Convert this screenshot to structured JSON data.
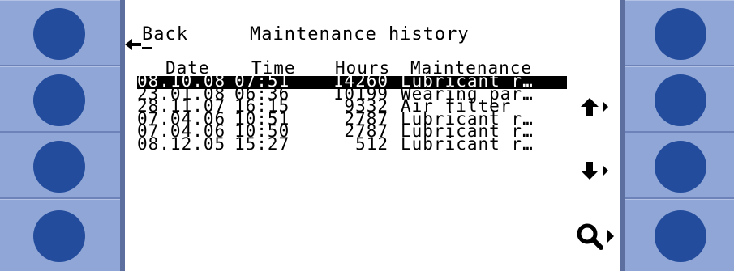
{
  "header": {
    "back_label": "Back",
    "title": "Maintenance history"
  },
  "table": {
    "columns": [
      "Date",
      "Time",
      "Hours",
      "Maintenance"
    ],
    "rows": [
      {
        "date": "08.10.08",
        "time": "07:51",
        "hours": "14260",
        "maintenance": "Lubricant r…",
        "selected": true
      },
      {
        "date": "23.01.08",
        "time": "06:36",
        "hours": "10199",
        "maintenance": "Wearing par…",
        "selected": false
      },
      {
        "date": "28.11.07",
        "time": "16:15",
        "hours": "9332",
        "maintenance": "Air filter",
        "selected": false
      },
      {
        "date": "07.04.06",
        "time": "10:51",
        "hours": "2787",
        "maintenance": "Lubricant r…",
        "selected": false
      },
      {
        "date": "07.04.06",
        "time": "10:50",
        "hours": "2787",
        "maintenance": "Lubricant r…",
        "selected": false
      },
      {
        "date": "08.12.05",
        "time": "15:27",
        "hours": "512",
        "maintenance": "Lubricant r…",
        "selected": false
      }
    ]
  },
  "softkeys": {
    "up": "up-arrow-icon",
    "down": "down-arrow-icon",
    "search": "magnifier-icon"
  },
  "colors": {
    "panel": "#8fa6d6",
    "button": "#234c9c",
    "screen": "#ffffff",
    "text": "#000000"
  }
}
